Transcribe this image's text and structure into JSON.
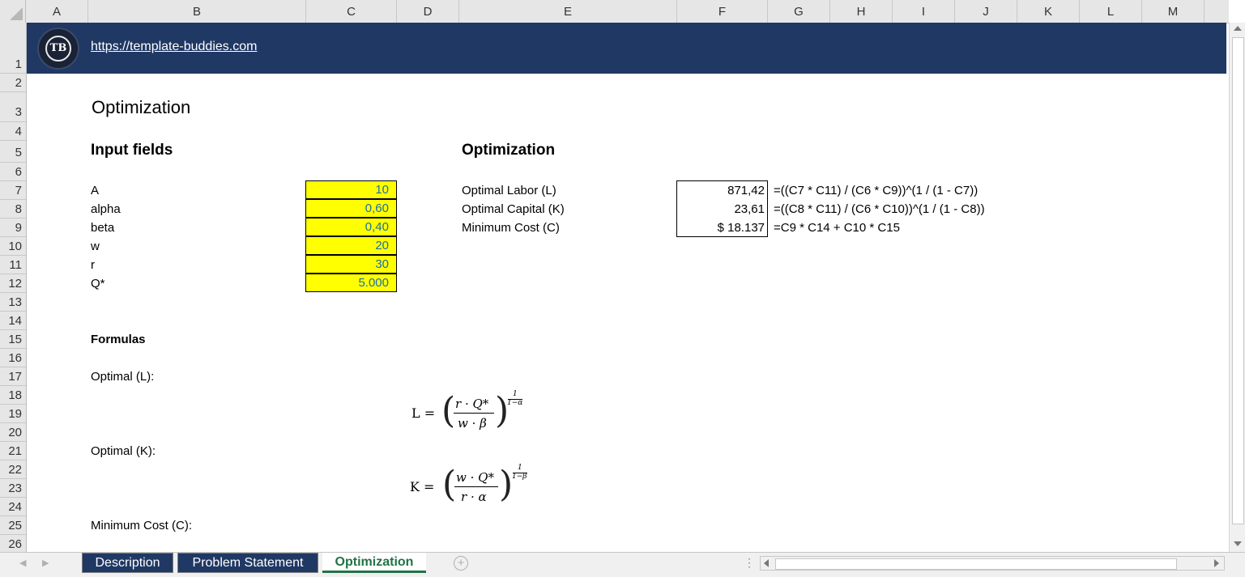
{
  "columns": [
    "A",
    "B",
    "C",
    "D",
    "E",
    "F",
    "G",
    "H",
    "I",
    "J",
    "K",
    "L",
    "M"
  ],
  "rows": [
    "1",
    "2",
    "3",
    "4",
    "5",
    "6",
    "7",
    "8",
    "9",
    "10",
    "11",
    "12",
    "13",
    "14",
    "15",
    "16",
    "17",
    "18",
    "19",
    "20",
    "21",
    "22",
    "23",
    "24",
    "25",
    "26"
  ],
  "banner": {
    "logo_text": "TB",
    "link": "https://template-buddies.com"
  },
  "title": "Optimization",
  "inputs": {
    "heading": "Input fields",
    "items": [
      {
        "label": "A",
        "value": "10"
      },
      {
        "label": "alpha",
        "value": "0,60"
      },
      {
        "label": "beta",
        "value": "0,40"
      },
      {
        "label": "w",
        "value": "20"
      },
      {
        "label": "r",
        "value": "30"
      },
      {
        "label": "Q*",
        "value": "5.000"
      }
    ]
  },
  "optimization": {
    "heading": "Optimization",
    "items": [
      {
        "label": "Optimal Labor (L)",
        "value": "871,42",
        "formula": "=((C7 * C11) / (C6 * C9))^(1 / (1 - C7))"
      },
      {
        "label": "Optimal Capital (K)",
        "value": "23,61",
        "formula": "=((C8 * C11) / (C6 * C10))^(1 / (1 - C8))"
      },
      {
        "label": "Minimum Cost (C)",
        "value": "$ 18.137",
        "formula": "=C9 * C14 + C10 * C15"
      }
    ]
  },
  "formulas": {
    "heading": "Formulas",
    "optimal_l": "Optimal (L):",
    "optimal_k": "Optimal (K):",
    "min_cost": "Minimum Cost (C):",
    "eq_l": {
      "lhs": "L =",
      "num": "r · Q*",
      "den": "w · β",
      "exp_num": "1",
      "exp_den": "1−α"
    },
    "eq_k": {
      "lhs": "K =",
      "num": "w · Q*",
      "den": "r · α",
      "exp_num": "1",
      "exp_den": "1−β"
    }
  },
  "tabs": {
    "items": [
      {
        "label": "Description"
      },
      {
        "label": "Problem Statement"
      },
      {
        "label": "Optimization"
      }
    ],
    "active": "Optimization"
  },
  "colors": {
    "banner": "#203864",
    "input_fill": "#ffff00",
    "input_text": "#1b6fa8",
    "active_tab": "#217346"
  }
}
